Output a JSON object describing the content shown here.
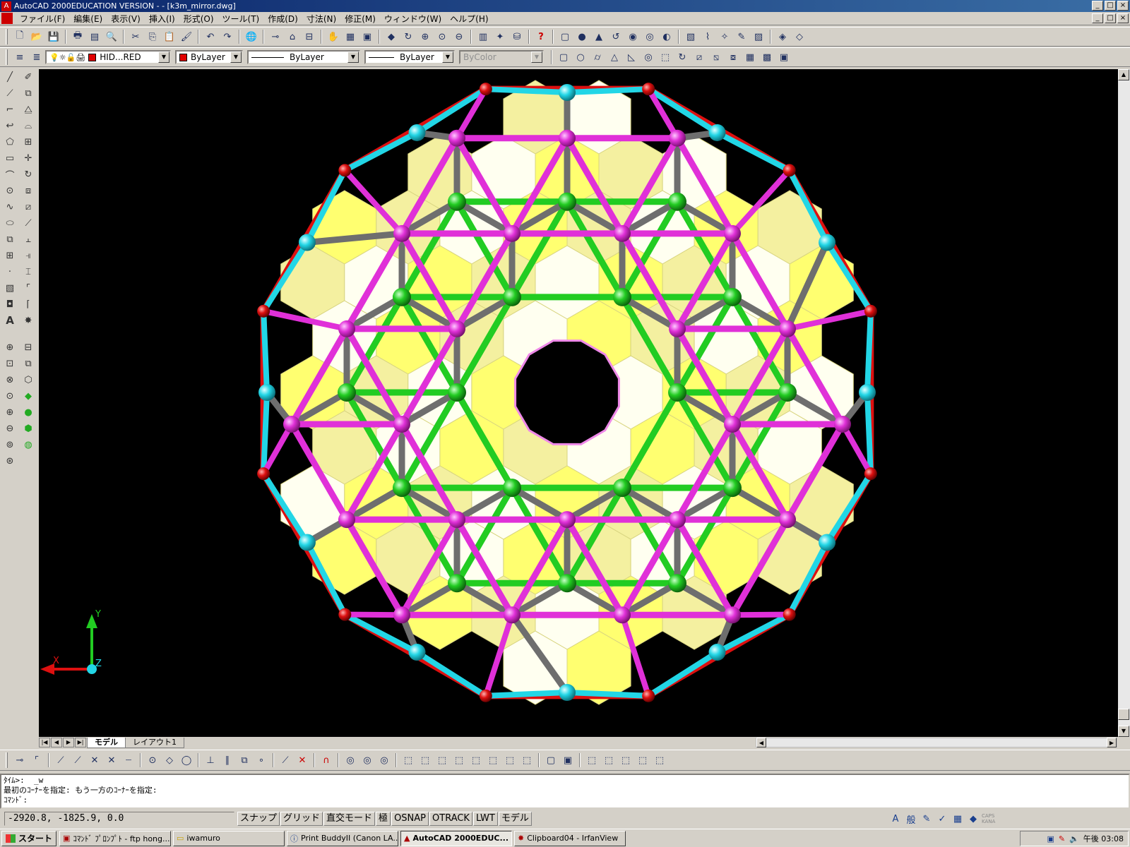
{
  "app": {
    "title": "AutoCAD 2000EDUCATION VERSION - - [k3m_mirror.dwg]",
    "window_buttons": [
      "_",
      "□",
      "×"
    ]
  },
  "menu": [
    "ファイル(F)",
    "編集(E)",
    "表示(V)",
    "挿入(I)",
    "形式(O)",
    "ツール(T)",
    "作成(D)",
    "寸法(N)",
    "修正(M)",
    "ウィンドウ(W)",
    "ヘルプ(H)"
  ],
  "properties_bar": {
    "layer": "HID...RED",
    "color": "ByLayer",
    "linetype": "ByLayer",
    "lineweight": "ByLayer",
    "plotstyle": "ByColor"
  },
  "tabs": [
    "モデル",
    "レイアウト1"
  ],
  "command_lines": [
    "ﾀｲﾑ>:  _w",
    "最初のｺｰﾅｰを指定: もう一方のｺｰﾅｰを指定:",
    "ｺﾏﾝﾄﾞ:"
  ],
  "status": {
    "coords": "-2920.8, -1825.9, 0.0",
    "modes": [
      "スナップ",
      "グリッド",
      "直交モード",
      "極",
      "OSNAP",
      "OTRACK",
      "LWT",
      "モデル"
    ]
  },
  "taskbar": {
    "start": "スタート",
    "tasks": [
      "ｺﾏﾝﾄﾞ ﾌﾟﾛﾝﾌﾟﾄ - ftp hong...",
      "iwamuro",
      "Print BuddyII (Canon LA...",
      "AutoCAD 2000EDUC...",
      "Clipboard04 - IrfanView"
    ],
    "clock": "午後 03:08"
  },
  "ucs": {
    "x": "X",
    "y": "Y",
    "z": "Z"
  },
  "colors": {
    "magenta": "#e030d8",
    "green": "#22cc22",
    "gray": "#6e6e6e",
    "cyan": "#22d6e6",
    "red": "#dd1010",
    "yellow": "#ffff70",
    "background": "#000000"
  },
  "icons": {
    "standard_toolbar": [
      "new-icon",
      "open-icon",
      "save-icon",
      "print-icon",
      "preview-icon",
      "find-icon",
      "cut-icon",
      "copy-icon",
      "paste-icon",
      "matchprop-icon",
      "undo-icon",
      "redo-icon",
      "hyperlink-icon",
      "pan-icon",
      "zoom-icon",
      "help-icon"
    ],
    "draw_tools": [
      "line-icon",
      "xline-icon",
      "pline-icon",
      "polygon-icon",
      "rectangle-icon",
      "arc-icon",
      "circle-icon",
      "spline-icon",
      "ellipse-icon",
      "block-icon",
      "point-icon",
      "hatch-icon",
      "region-icon",
      "text-icon"
    ],
    "modify_tools": [
      "erase-icon",
      "copy-icon",
      "mirror-icon",
      "offset-icon",
      "array-icon",
      "move-icon",
      "rotate-icon",
      "scale-icon",
      "stretch-icon",
      "trim-icon",
      "extend-icon",
      "break-icon",
      "chamfer-icon",
      "fillet-icon",
      "explode-icon"
    ]
  }
}
